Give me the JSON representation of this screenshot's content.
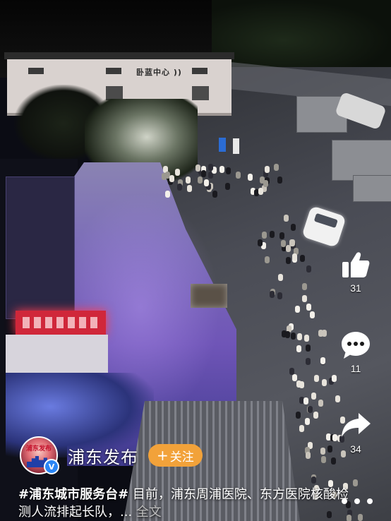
{
  "video": {
    "building_sign": "卧蓝中心 ))"
  },
  "actions": {
    "like": {
      "icon": "thumbs-up-icon",
      "count": "31"
    },
    "comment": {
      "icon": "comment-bubble-icon",
      "count": "11"
    },
    "share": {
      "icon": "share-arrow-icon",
      "count": "34"
    }
  },
  "author": {
    "avatar_text": "浦东发布",
    "name": "浦东发布",
    "follow_label": "关注",
    "follow_plus": "+",
    "verified_mark": "V"
  },
  "caption": {
    "hashtag": "#浦东城市服务台#",
    "text": " 目前，浦东周浦医院、东方医院核酸检测人流排起长队，...",
    "more": "全文"
  },
  "colors": {
    "follow_button": "#f2a23a",
    "verified_badge": "#2b86f5",
    "led_sign": "#d0273a"
  }
}
